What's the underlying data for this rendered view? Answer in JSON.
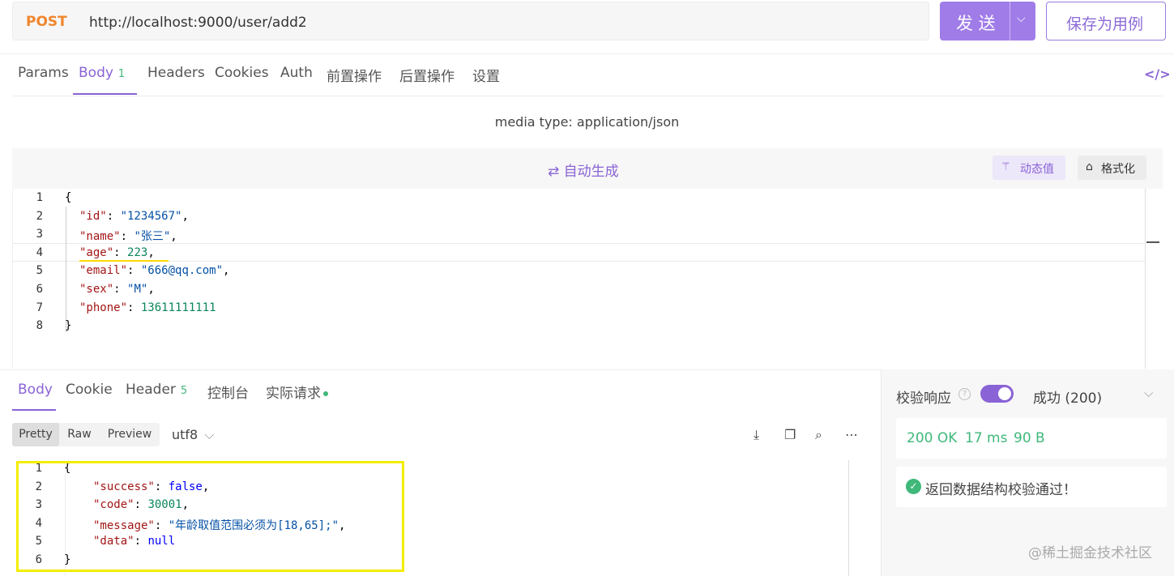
{
  "request": {
    "method": "POST",
    "url": "http://localhost:9000/user/add2",
    "send_label": "发 送",
    "save_label": "保存为用例"
  },
  "tabs": [
    {
      "label": "Params"
    },
    {
      "label": "Body",
      "count": "1"
    },
    {
      "label": "Headers"
    },
    {
      "label": "Cookies"
    },
    {
      "label": "Auth"
    },
    {
      "label": "前置操作"
    },
    {
      "label": "后置操作"
    },
    {
      "label": "设置"
    }
  ],
  "code_toggle": "</>",
  "media_type": "media type: application/json",
  "editor": {
    "autogen_label": "⇄ 自动生成",
    "dynamic_label": "动态值",
    "format_label": "格式化",
    "lines": [
      {
        "no": "1",
        "text": "{"
      },
      {
        "no": "2",
        "key": "\"id\"",
        "val": "\"1234567\"",
        "vtype": "s",
        "end": ","
      },
      {
        "no": "3",
        "key": "\"name\"",
        "val": "\"张三\"",
        "vtype": "s",
        "end": ","
      },
      {
        "no": "4",
        "key": "\"age\"",
        "val": "223",
        "vtype": "n",
        "end": ","
      },
      {
        "no": "5",
        "key": "\"email\"",
        "val": "\"666@qq.com\"",
        "vtype": "s",
        "end": ","
      },
      {
        "no": "6",
        "key": "\"sex\"",
        "val": "\"M\"",
        "vtype": "s",
        "end": ","
      },
      {
        "no": "7",
        "key": "\"phone\"",
        "val": "13611111111",
        "vtype": "n",
        "end": ""
      },
      {
        "no": "8",
        "text": "}"
      }
    ]
  },
  "response": {
    "tabs": [
      {
        "label": "Body"
      },
      {
        "label": "Cookie"
      },
      {
        "label": "Header",
        "count": "5"
      },
      {
        "label": "控制台"
      },
      {
        "label": "实际请求"
      }
    ],
    "views": [
      "Pretty",
      "Raw",
      "Preview"
    ],
    "encoding": "utf8",
    "lines": [
      {
        "no": "1",
        "text": "{"
      },
      {
        "no": "2",
        "key": "\"success\"",
        "val": "false",
        "vtype": "b",
        "end": ","
      },
      {
        "no": "3",
        "key": "\"code\"",
        "val": "30001",
        "vtype": "n",
        "end": ","
      },
      {
        "no": "4",
        "key": "\"message\"",
        "val": "\"年龄取值范围必须为[18,65];\"",
        "vtype": "s",
        "end": ","
      },
      {
        "no": "5",
        "key": "\"data\"",
        "val": "null",
        "vtype": "b",
        "end": ""
      },
      {
        "no": "6",
        "text": "}"
      }
    ]
  },
  "validation": {
    "title": "校验响应",
    "enabled": true,
    "result": "成功 (200)",
    "status": "200 OK",
    "time": "17 ms",
    "size": "90 B",
    "message": "返回数据结构校验通过！",
    "watermark": "@稀土掘金技术社区"
  }
}
